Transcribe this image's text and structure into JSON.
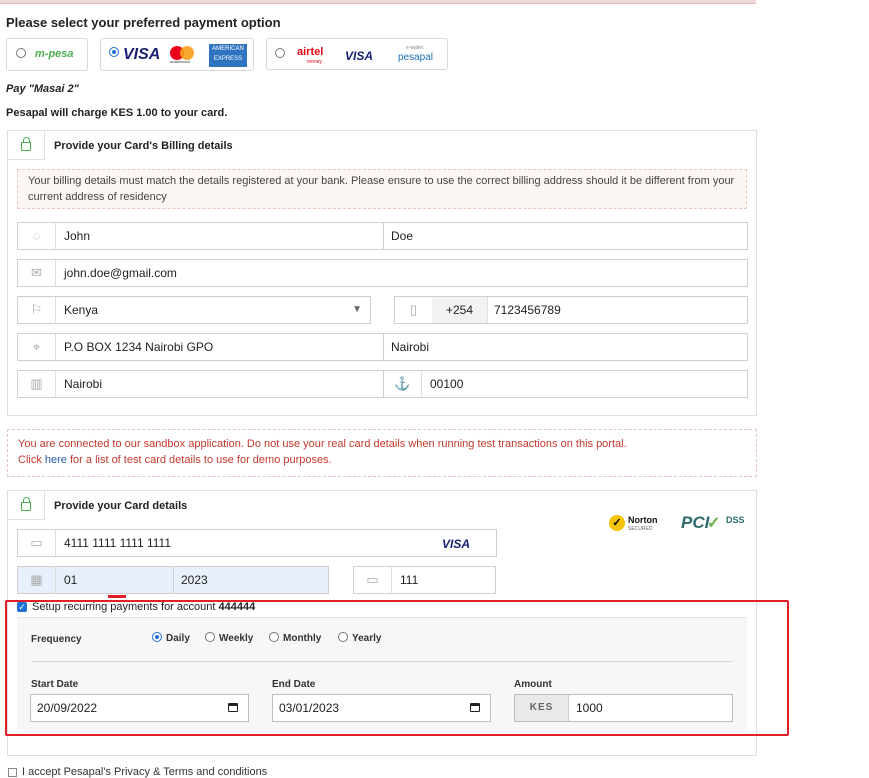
{
  "heading": "Please select your preferred payment option",
  "payment_options": {
    "mpesa": {
      "logo": "m-pesa",
      "selected": false
    },
    "cards": {
      "visa": "VISA",
      "mastercard": "mastercard",
      "amex_top": "AMERICAN",
      "amex_bottom": "EXPRESS",
      "selected": true
    },
    "airtel": {
      "airtel": "airtel",
      "airtel_sub": "money",
      "visa": "VISA",
      "ewallet_top": "e-wallet",
      "ewallet": "pesapal",
      "selected": false
    }
  },
  "pay_label": "Pay \"Masai 2\"",
  "charge_text": "Pesapal will charge KES 1.00 to your card.",
  "billing": {
    "title": "Provide your Card's Billing details",
    "notice": "Your billing details must match the details registered at your bank. Please ensure to use the correct billing address should it be different from your current address of residency",
    "first_name": "John",
    "last_name": "Doe",
    "email": "john.doe@gmail.com",
    "country": "Kenya",
    "phone_code": "+254",
    "phone": "7123456789",
    "address": "P.O BOX 1234 Nairobi GPO",
    "city": "Nairobi",
    "state": "Nairobi",
    "postal": "00100"
  },
  "sandbox": {
    "line1": "You are connected to our sandbox application. Do not use your real card details when running test transactions on this portal.",
    "click": "Click",
    "here": "here",
    "line2": "for a list of test card details to use for demo purposes."
  },
  "card": {
    "title": "Provide your Card details",
    "number": "4111 1111 1111 1111",
    "brand": "VISA",
    "month": "01",
    "year": "2023",
    "cvv": "111",
    "norton": "Norton",
    "norton_sub": "SECURED",
    "pci": "PCI",
    "dss": "DSS"
  },
  "recurring": {
    "label_prefix": "Setup recurring payments for account",
    "account": "444444",
    "checked": true,
    "frequency_label": "Frequency",
    "options": [
      "Daily",
      "Weekly",
      "Monthly",
      "Yearly"
    ],
    "selected": "Daily",
    "start_label": "Start Date",
    "start_value": "20/09/2022",
    "end_label": "End Date",
    "end_value": "03/01/2023",
    "amount_label": "Amount",
    "currency": "KES",
    "amount": "1000"
  },
  "accept_text": "I accept Pesapal's Privacy & Terms and conditions",
  "colors": {
    "accent": "#1f6fd6",
    "highlight": "#e21f26",
    "lock": "#4caf50",
    "warn": "#c0392b"
  }
}
